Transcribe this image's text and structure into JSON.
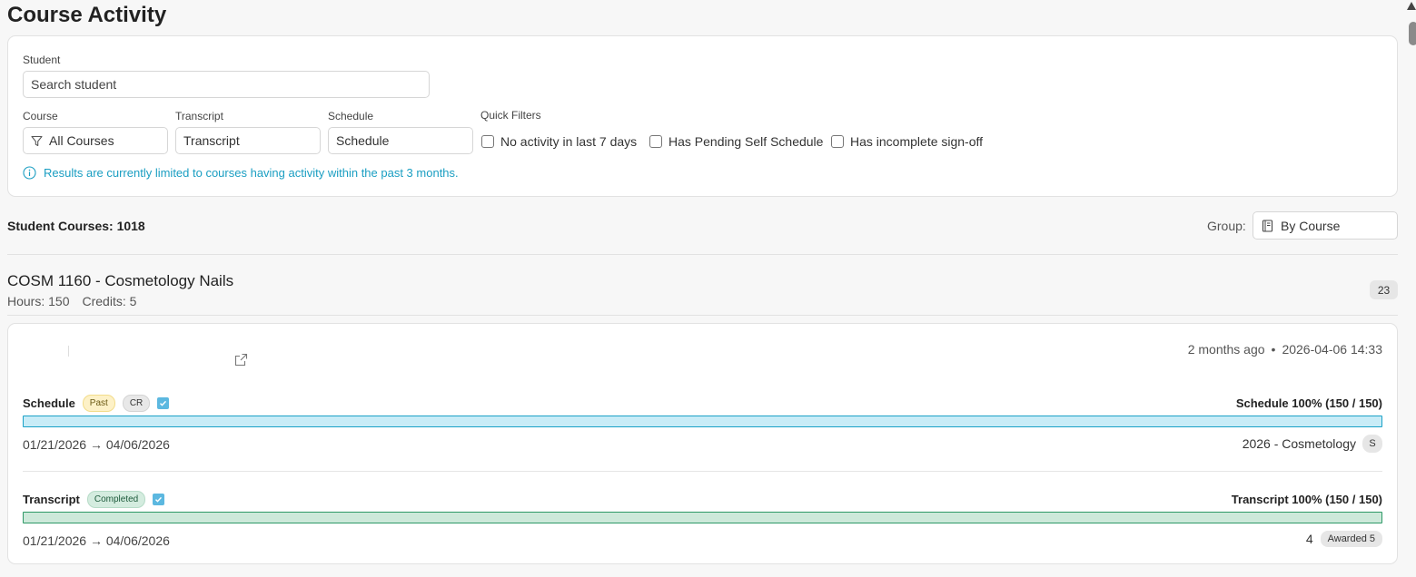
{
  "page": {
    "title": "Course Activity"
  },
  "filters": {
    "student_label": "Student",
    "student_placeholder": "Search student",
    "course_label": "Course",
    "course_value": "All Courses",
    "transcript_label": "Transcript",
    "transcript_value": "Transcript",
    "schedule_label": "Schedule",
    "schedule_value": "Schedule",
    "quick_filters_label": "Quick Filters",
    "quick_filters": [
      {
        "label": "No activity in last 7 days",
        "checked": false
      },
      {
        "label": "Has Pending Self Schedule",
        "checked": false
      },
      {
        "label": "Has incomplete sign-off",
        "checked": false
      }
    ],
    "info_text": "Results are currently limited to courses having activity within the past 3 months."
  },
  "summary": {
    "student_courses": "Student Courses: 1018",
    "group_label": "Group:",
    "group_value": "By Course"
  },
  "course": {
    "name": "COSM 1160 - Cosmetology Nails",
    "hours": "Hours: 150",
    "credits": "Credits: 5",
    "count": "23",
    "entry": {
      "relative_time": "2 months ago",
      "separator": "•",
      "datetime": "2026-04-06 14:33",
      "schedule": {
        "label": "Schedule",
        "status": "Past",
        "tag": "CR",
        "progress_text": "Schedule 100% (150 / 150)",
        "progress_fraction": 1.0,
        "dates": "01/21/2026 → 04/06/2026",
        "program": "2026 - Cosmetology",
        "program_badge": "S"
      },
      "transcript": {
        "label": "Transcript",
        "status": "Completed",
        "progress_text": "Transcript 100% (150 / 150)",
        "progress_fraction": 1.0,
        "dates": "01/21/2026 → 04/06/2026",
        "grade": "4",
        "awarded": "Awarded 5"
      }
    }
  },
  "colors": {
    "info": "#1a9ec2",
    "schedule_bar": "#c8ecf7",
    "transcript_bar": "#cde9da",
    "check_blue": "#5cb8e0"
  }
}
